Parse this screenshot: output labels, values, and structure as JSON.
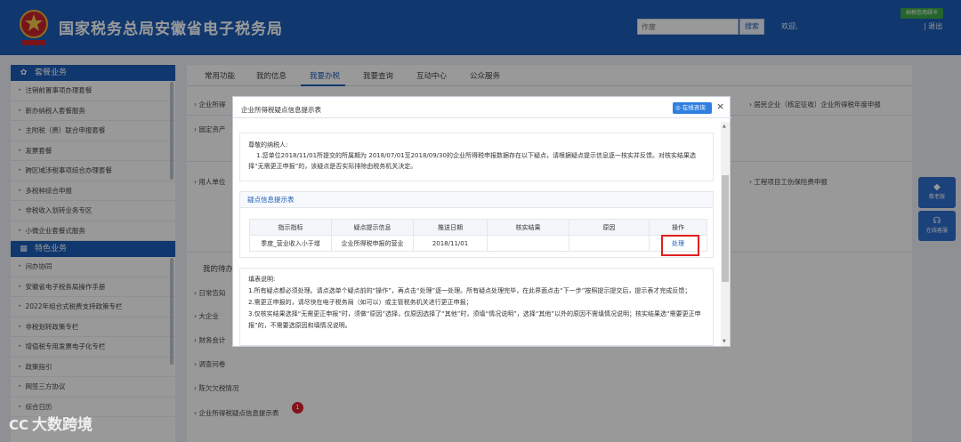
{
  "header": {
    "title": "国家税务总局安徽省电子税务局",
    "search_placeholder": "作废",
    "search_button": "搜索",
    "welcome": "欢迎,",
    "credit_card": "纳税信用绿卡",
    "logout": "| 退出"
  },
  "sidebar": {
    "section1_title": "套餐业务",
    "section1_items": [
      "注销前置事项办理套餐",
      "新办纳税人套餐服务",
      "主附税（费）联合申报套餐",
      "发票套餐",
      "跨区域涉税事项综合办理套餐",
      "多税种综合申报",
      "非税收入划转业务专区",
      "小微企业套餐式服务"
    ],
    "section2_title": "特色业务",
    "section2_items": [
      "问办协同",
      "安徽省电子税务局操作手册",
      "2022年组合式税费支持政策专栏",
      "非税划转政策专栏",
      "增值税专用发票电子化专栏",
      "政策指引",
      "网签三方协议",
      "综合日历"
    ]
  },
  "main": {
    "tabs": [
      "常用功能",
      "我的信息",
      "我要办税",
      "我要查询",
      "互动中心",
      "公众服务"
    ],
    "active_tab_index": 2,
    "func_rows": [
      "企业所得",
      "固定资产",
      "用人单位"
    ],
    "right_rows": [
      "居民企业（核定征收）企业所得税年度申报",
      "工程项目工伤保险费申报"
    ],
    "todo_title": "我的待办",
    "todo_items": [
      "日常告知",
      "大企业",
      "财务会计",
      "调查问卷",
      "陈欠欠税情况",
      "企业所得税疑点信息提示表"
    ],
    "todo_badge": "1"
  },
  "float_buttons": [
    "敬老版",
    "在线客服"
  ],
  "modal": {
    "title": "企业所得税疑点信息提示表",
    "consult_button": "在线咨询",
    "close": "×",
    "greeting": "尊敬的纳税人:",
    "notice": "1.您单位2018/11/01所提交的所属期为 2018/07/01至2018/09/30的企业所得税申报数据存在以下疑点，请根据疑点提示信息逐一核实并反馈。对核实结果选择“无需更正申报”的，该疑点是否实际排除由税务机关决定。",
    "section_title": "疑点信息提示表",
    "table_headers": [
      "指示指标",
      "疑点提示信息",
      "推送日期",
      "核实结果",
      "原因",
      "操作"
    ],
    "table_rows": [
      [
        "季度_营业收入小于增",
        "企业所得税申报的营业",
        "2018/11/01",
        "",
        "",
        "处理"
      ]
    ],
    "fill_title": "填表说明:",
    "fill_lines": [
      "1.所有疑点都必须处理。请点选单个疑点前的“操作”，再点击“处理”逐一处理。所有疑点处理完毕，在此界面点击“下一步”按照提示提交后，提示表才完成反馈；",
      "2.需更正申报的，请尽快在电子税务局（如可以）或主管税务机关进行更正申报；",
      "3.仅核实结果选择“无需更正申报”时，须做“原因”选择，仅原因选择了“其他”时，须填“情况说明”，选择“其他”以外的原因不需填情况说明；核实结果选“需要更正申报”的，不需要选原因和填情况说明。"
    ]
  },
  "watermark": "大数跨境",
  "colors": {
    "brand_blue": "#1b5db8",
    "highlight_red": "#e01f1f",
    "badge_red": "#d9232d",
    "credit_green": "#3ea84a"
  }
}
